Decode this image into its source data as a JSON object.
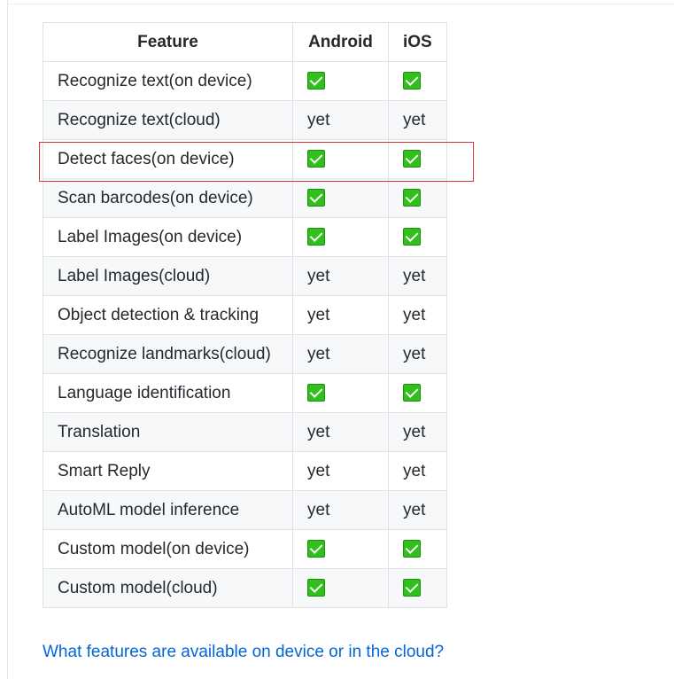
{
  "table": {
    "headers": [
      "Feature",
      "Android",
      "iOS"
    ],
    "check_icon": "white-heavy-check-mark-icon",
    "check_color": "#2fc019",
    "rows": [
      {
        "feature": "Recognize text(on device)",
        "android": "check",
        "ios": "check"
      },
      {
        "feature": "Recognize text(cloud)",
        "android": "yet",
        "ios": "yet"
      },
      {
        "feature": "Detect faces(on device)",
        "android": "check",
        "ios": "check",
        "highlighted": true
      },
      {
        "feature": "Scan barcodes(on device)",
        "android": "check",
        "ios": "check"
      },
      {
        "feature": "Label Images(on device)",
        "android": "check",
        "ios": "check"
      },
      {
        "feature": "Label Images(cloud)",
        "android": "yet",
        "ios": "yet"
      },
      {
        "feature": "Object detection & tracking",
        "android": "yet",
        "ios": "yet"
      },
      {
        "feature": "Recognize landmarks(cloud)",
        "android": "yet",
        "ios": "yet"
      },
      {
        "feature": "Language identification",
        "android": "check",
        "ios": "check"
      },
      {
        "feature": "Translation",
        "android": "yet",
        "ios": "yet"
      },
      {
        "feature": "Smart Reply",
        "android": "yet",
        "ios": "yet"
      },
      {
        "feature": "AutoML model inference",
        "android": "yet",
        "ios": "yet"
      },
      {
        "feature": "Custom model(on device)",
        "android": "check",
        "ios": "check"
      },
      {
        "feature": "Custom model(cloud)",
        "android": "check",
        "ios": "check"
      }
    ]
  },
  "highlight_color": "#d8323c",
  "faq_link": {
    "text": "What features are available on device or in the cloud?",
    "color": "#0366d6"
  }
}
